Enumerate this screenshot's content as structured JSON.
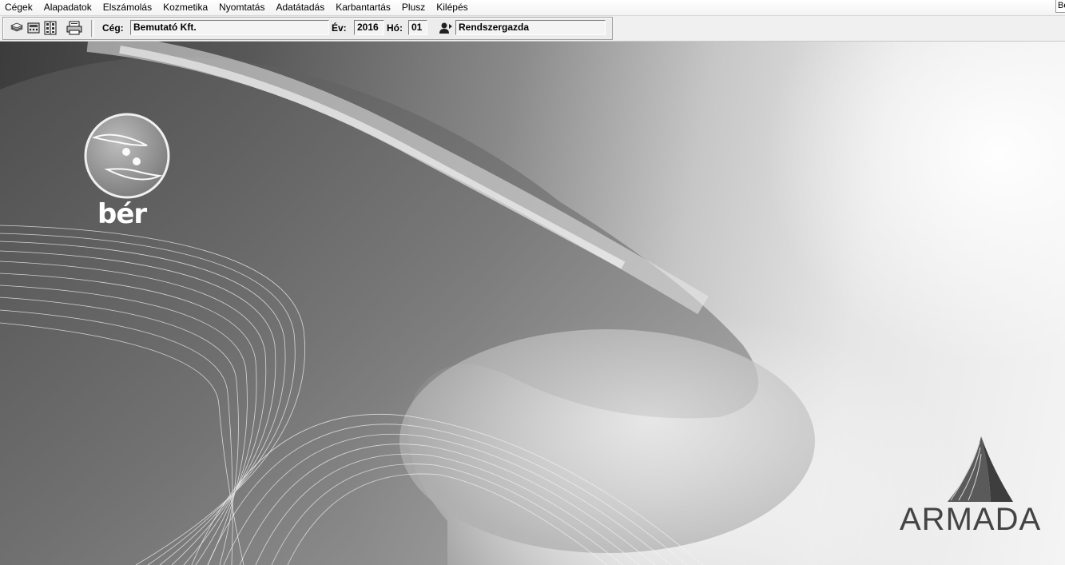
{
  "menu": {
    "items": [
      "Cégek",
      "Alapadatok",
      "Elszámolás",
      "Kozmetika",
      "Nyomtatás",
      "Adatátadás",
      "Karbantartás",
      "Plusz",
      "Kilépés"
    ],
    "clipped_label": "Be"
  },
  "toolbar": {
    "icons": [
      "layers-icon",
      "calculator-icon",
      "ledger-icon",
      "printer-icon"
    ],
    "company_label": "Cég:",
    "company_value": "Bemutató Kft.",
    "year_label": "Év:",
    "year_value": "2016",
    "month_label": "Hó:",
    "month_value": "01",
    "user_value": "Rendszergazda",
    "user_icon": "user-icon"
  },
  "branding": {
    "product_name": "bér",
    "company_logo": "ARMADA"
  }
}
